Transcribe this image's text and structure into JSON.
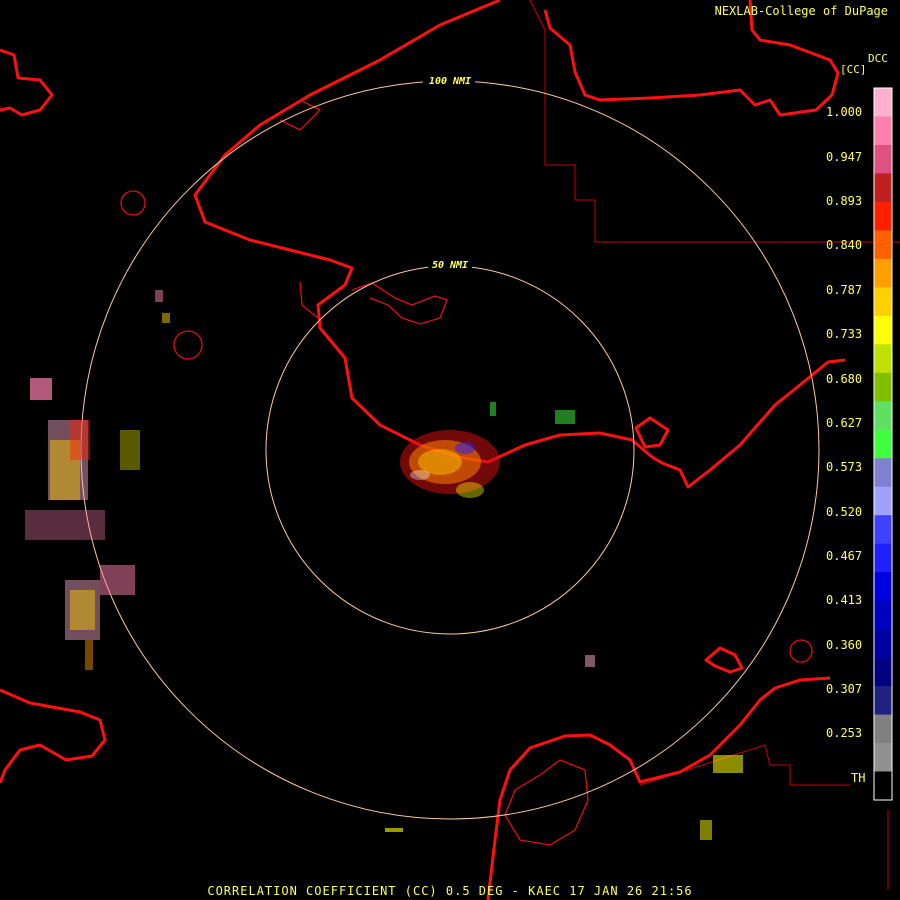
{
  "credit": "NEXLAB-College of DuPage",
  "product_code": "DCC",
  "unit": "[CC]",
  "range_rings": [
    "50 NMI",
    "100 NMI"
  ],
  "colorbar": {
    "ticks": [
      "1.000",
      "0.947",
      "0.893",
      "0.840",
      "0.787",
      "0.733",
      "0.680",
      "0.627",
      "0.573",
      "0.520",
      "0.467",
      "0.413",
      "0.360",
      "0.307",
      "0.253"
    ],
    "threshold_label": "TH",
    "colors": [
      "#ffb0d0",
      "#ff80b0",
      "#e05080",
      "#c02020",
      "#ff2000",
      "#ff6000",
      "#ffa000",
      "#ffd000",
      "#ffff00",
      "#c0e000",
      "#80c000",
      "#60e060",
      "#40ff40",
      "#8080d0",
      "#a0a0ff",
      "#4040ff",
      "#2020ff",
      "#0000e0",
      "#0000c0",
      "#0000a0",
      "#000080",
      "#202080",
      "#808080",
      "#909090",
      "#000000"
    ]
  },
  "footer": "CORRELATION COEFFICIENT (CC) 0.5 DEG - KAEC 17 JAN 26 21:56"
}
